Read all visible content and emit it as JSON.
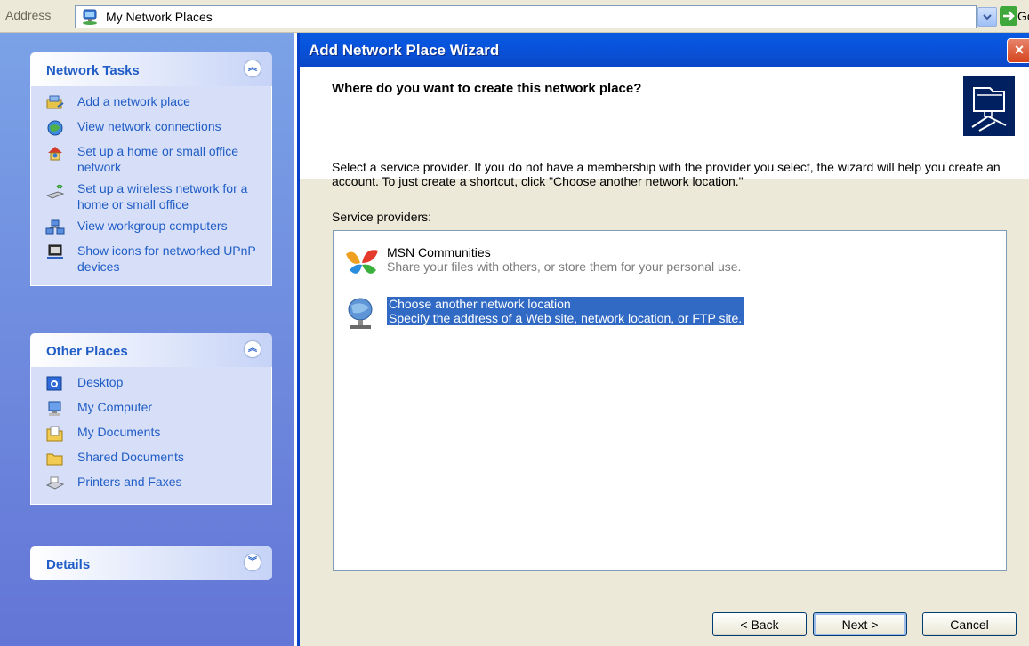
{
  "address_bar": {
    "label": "Address",
    "value": "My Network Places",
    "go_label": "Go"
  },
  "task_pane": {
    "network_tasks": {
      "title": "Network Tasks",
      "items": [
        {
          "label": "Add a network place",
          "icon": "add-network-place-icon"
        },
        {
          "label": "View network connections",
          "icon": "network-connections-icon"
        },
        {
          "label": "Set up a home or small office network",
          "icon": "home-network-icon"
        },
        {
          "label": "Set up a wireless network for a home or small office",
          "icon": "wireless-network-icon"
        },
        {
          "label": "View workgroup computers",
          "icon": "workgroup-icon"
        },
        {
          "label": "Show icons for networked UPnP devices",
          "icon": "upnp-icon"
        }
      ]
    },
    "other_places": {
      "title": "Other Places",
      "items": [
        {
          "label": "Desktop",
          "icon": "desktop-icon"
        },
        {
          "label": "My Computer",
          "icon": "my-computer-icon"
        },
        {
          "label": "My Documents",
          "icon": "my-documents-icon"
        },
        {
          "label": "Shared Documents",
          "icon": "folder-icon"
        },
        {
          "label": "Printers and Faxes",
          "icon": "printer-icon"
        }
      ]
    },
    "details": {
      "title": "Details"
    }
  },
  "dialog": {
    "title": "Add Network Place Wizard",
    "close_label": "×",
    "question": "Where do you want to create this network place?",
    "description": "Select a service provider.  If you do not have a membership with the provider you select, the wizard will help you create an account.  To just create a shortcut, click \"Choose another network location.\"",
    "providers_label": "Service providers:",
    "providers": [
      {
        "name": "MSN Communities",
        "description": "Share your files with others, or store them for your personal use.",
        "selected": false
      },
      {
        "name": "Choose another network location",
        "description": "Specify the address of a Web site, network location, or FTP site.",
        "selected": true
      }
    ],
    "buttons": {
      "back": "< Back",
      "next": "Next >",
      "cancel": "Cancel"
    }
  },
  "colors": {
    "task_link": "#215dc6",
    "selection": "#316ac5",
    "titlebar": "#0a5be0"
  }
}
